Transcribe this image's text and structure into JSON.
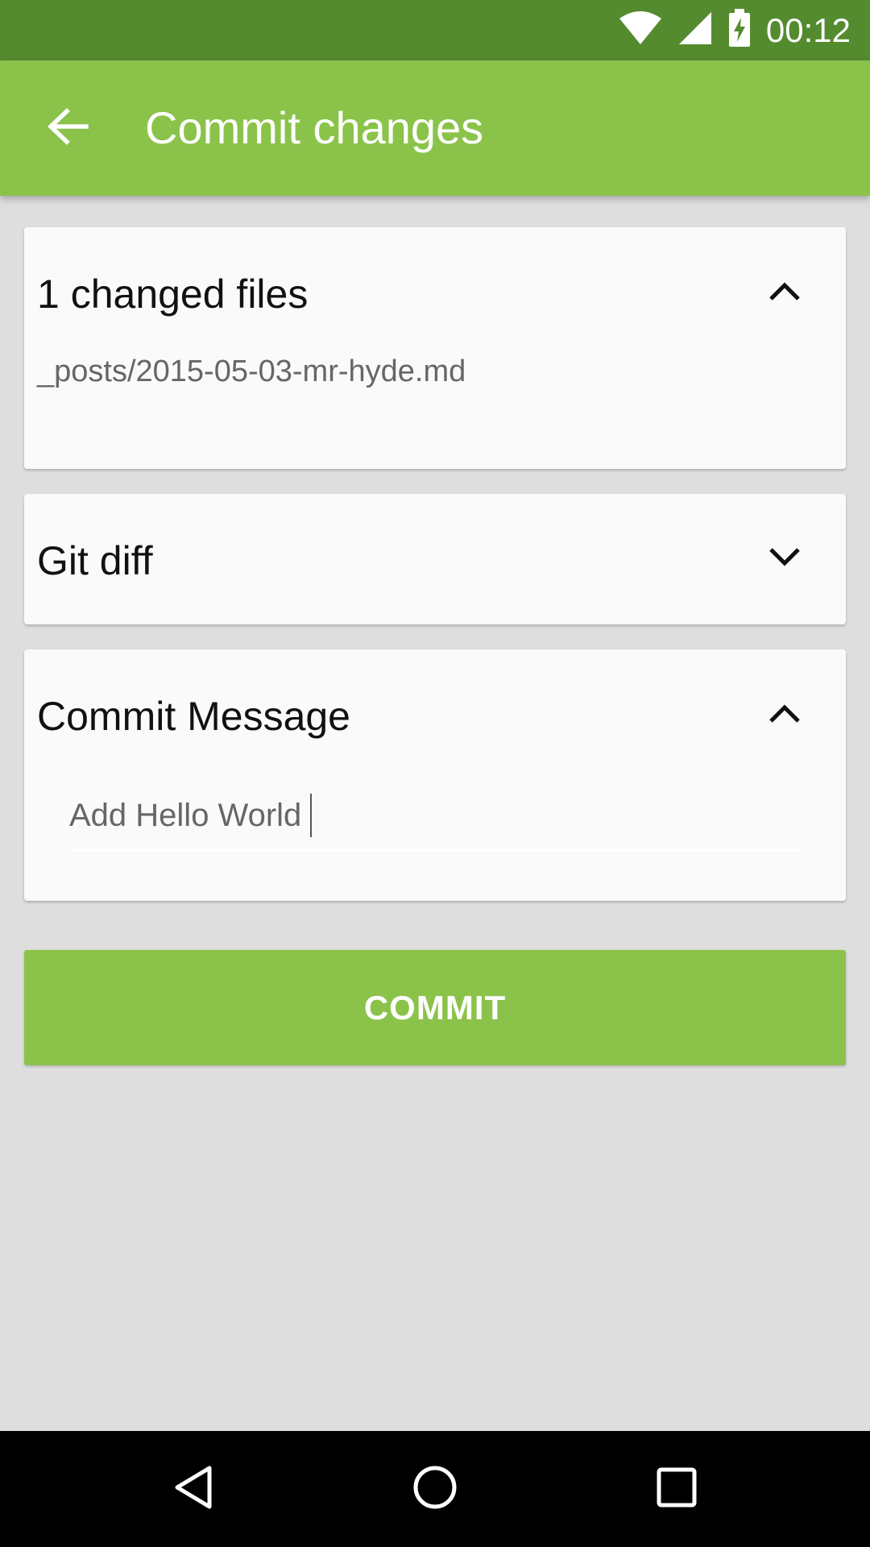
{
  "status_bar": {
    "time": "00:12",
    "icons": [
      "wifi-icon",
      "signal-icon",
      "battery-charging-icon"
    ],
    "background": "#558b2f"
  },
  "app_bar": {
    "title": "Commit changes",
    "back_icon": "arrow-back-icon",
    "background": "#8bc34a"
  },
  "changed_files_card": {
    "title": "1 changed files",
    "toggle_icon": "chevron-up-icon",
    "files": [
      "_posts/2015-05-03-mr-hyde.md"
    ]
  },
  "git_diff_card": {
    "title": "Git diff",
    "toggle_icon": "chevron-down-icon"
  },
  "commit_message_card": {
    "title": "Commit Message",
    "toggle_icon": "chevron-up-icon",
    "input_value": "Add Hello World"
  },
  "commit_button": {
    "label": "COMMIT",
    "color": "#8bc34a"
  },
  "nav_bar": {
    "icons": [
      "back-triangle-icon",
      "home-circle-icon",
      "recents-square-icon"
    ]
  }
}
